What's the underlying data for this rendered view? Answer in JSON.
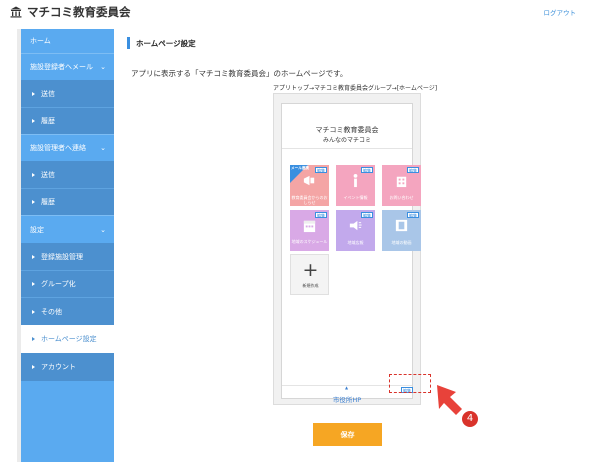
{
  "header": {
    "app_title": "マチコミ教育委員会",
    "logout_label": "ログアウト"
  },
  "sidebar": {
    "items": [
      {
        "label": "ホーム",
        "type": "main"
      },
      {
        "label": "施設登録者へメール",
        "type": "main",
        "expandable": true
      },
      {
        "label": "送信",
        "type": "sub"
      },
      {
        "label": "履歴",
        "type": "sub"
      },
      {
        "label": "施設管理者へ連絡",
        "type": "main",
        "expandable": true
      },
      {
        "label": "送信",
        "type": "sub"
      },
      {
        "label": "履歴",
        "type": "sub"
      },
      {
        "label": "設定",
        "type": "main",
        "expandable": true
      },
      {
        "label": "登録施設管理",
        "type": "sub"
      },
      {
        "label": "グループ化",
        "type": "sub"
      },
      {
        "label": "その他",
        "type": "sub"
      },
      {
        "label": "ホームページ設定",
        "type": "sub",
        "active": true
      },
      {
        "label": "アカウント",
        "type": "sub"
      }
    ],
    "chevron": "⌄"
  },
  "main": {
    "section_title": "ホームページ設定",
    "description": "アプリに表示する「マチコミ教育委員会」のホームページです。",
    "breadcrumb": "アプリトップ→マチコミ教育委員会グループ→[ホームページ]"
  },
  "preview": {
    "title": "マチコミ教育委員会",
    "subtitle": "みんなのマチコミ",
    "tiles": [
      {
        "label": "教育委員会からのおしらせ",
        "color": "#f4a5a5",
        "icon": "megaphone-icon",
        "ribbon": "メール連携",
        "edit": "編集"
      },
      {
        "label": "イベント情報",
        "color": "#f4a5bf",
        "icon": "info-icon",
        "edit": "編集"
      },
      {
        "label": "お問い合わせ",
        "color": "#f4a5bf",
        "icon": "building-icon",
        "edit": "編集"
      },
      {
        "label": "地域のスケジュール",
        "color": "#d9a9e6",
        "icon": "calendar-icon",
        "edit": "編集"
      },
      {
        "label": "地域広報",
        "color": "#c2a9ec",
        "icon": "speaker-icon",
        "edit": "編集"
      },
      {
        "label": "地域の動画",
        "color": "#a9c6e8",
        "icon": "film-icon",
        "edit": "編集"
      }
    ],
    "add_tile_label": "新規作成",
    "add_icon": "+",
    "footer_link": "市役所HP",
    "footer_up_arrow": "▲",
    "footer_edit": "編集"
  },
  "step": {
    "number": "4",
    "highlight_color": "#d9332b"
  },
  "save_label": "保存",
  "colors": {
    "sidebar_bg": "#5aaaf0",
    "sidebar_sub_bg": "#4c90cf",
    "accent": "#3a8fe0",
    "save_button": "#f6a623"
  }
}
